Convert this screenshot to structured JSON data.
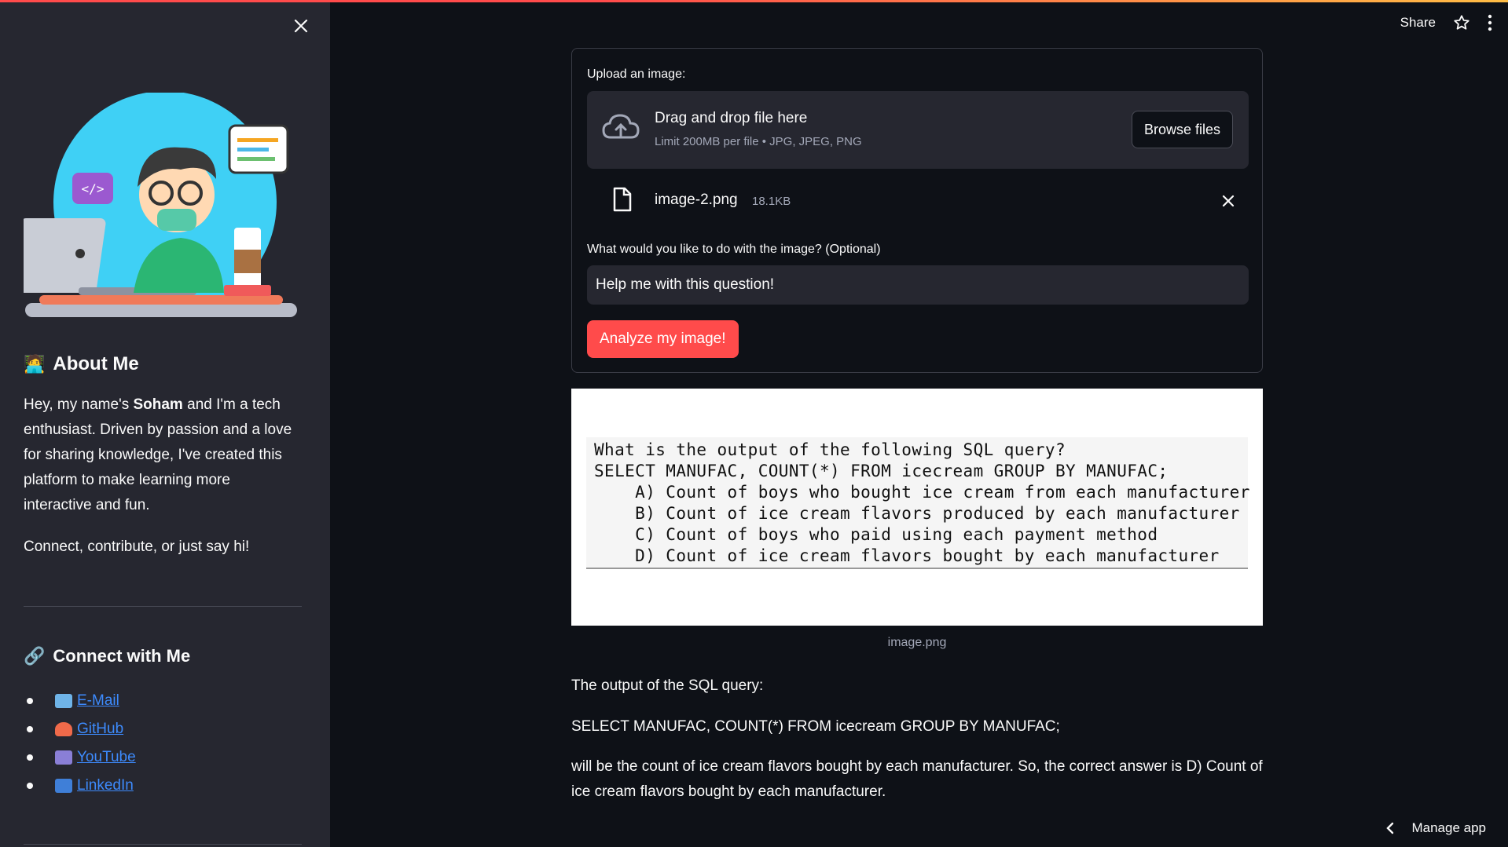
{
  "sidebar": {
    "about_title": "About Me",
    "about_emoji": "🧑‍💻",
    "about_pre": "Hey, my name's ",
    "about_name": "Soham",
    "about_post": " and I'm a tech enthusiast. Driven by passion and a love for sharing knowledge, I've created this platform to make learning more interactive and fun.",
    "about_cta": "Connect, contribute, or just say hi!",
    "connect_title": "Connect with Me",
    "connect_emoji": "🔗",
    "links": [
      {
        "label": "E-Mail",
        "icon": "email-icon"
      },
      {
        "label": "GitHub",
        "icon": "github-icon"
      },
      {
        "label": "YouTube",
        "icon": "youtube-icon"
      },
      {
        "label": "LinkedIn",
        "icon": "linkedin-icon"
      }
    ]
  },
  "header": {
    "share": "Share"
  },
  "uploader": {
    "label": "Upload an image:",
    "drag_text": "Drag and drop file here",
    "limit_text": "Limit 200MB per file • JPG, JPEG, PNG",
    "browse": "Browse files",
    "file_name": "image-2.png",
    "file_size": "18.1KB"
  },
  "prompt": {
    "label": "What would you like to do with the image? (Optional)",
    "value": "Help me with this question!"
  },
  "analyze_button": "Analyze my image!",
  "image": {
    "lines": [
      "What is the output of the following SQL query?",
      "SELECT MANUFAC, COUNT(*) FROM icecream GROUP BY MANUFAC;",
      "    A) Count of boys who bought ice cream from each manufacturer",
      "    B) Count of ice cream flavors produced by each manufacturer",
      "    C) Count of boys who paid using each payment method",
      "    D) Count of ice cream flavors bought by each manufacturer"
    ],
    "caption": "image.png"
  },
  "answer": {
    "p1": "The output of the SQL query:",
    "p2": "SELECT MANUFAC, COUNT(*) FROM icecream GROUP BY MANUFAC;",
    "p3": "will be the count of ice cream flavors bought by each manufacturer. So, the correct answer is D) Count of ice cream flavors bought by each manufacturer."
  },
  "footer": {
    "manage": "Manage app"
  },
  "colors": {
    "accent": "#ff4b4b",
    "sidebar_bg": "#262730",
    "bg": "#0e1117",
    "link": "#3d8bfd"
  }
}
